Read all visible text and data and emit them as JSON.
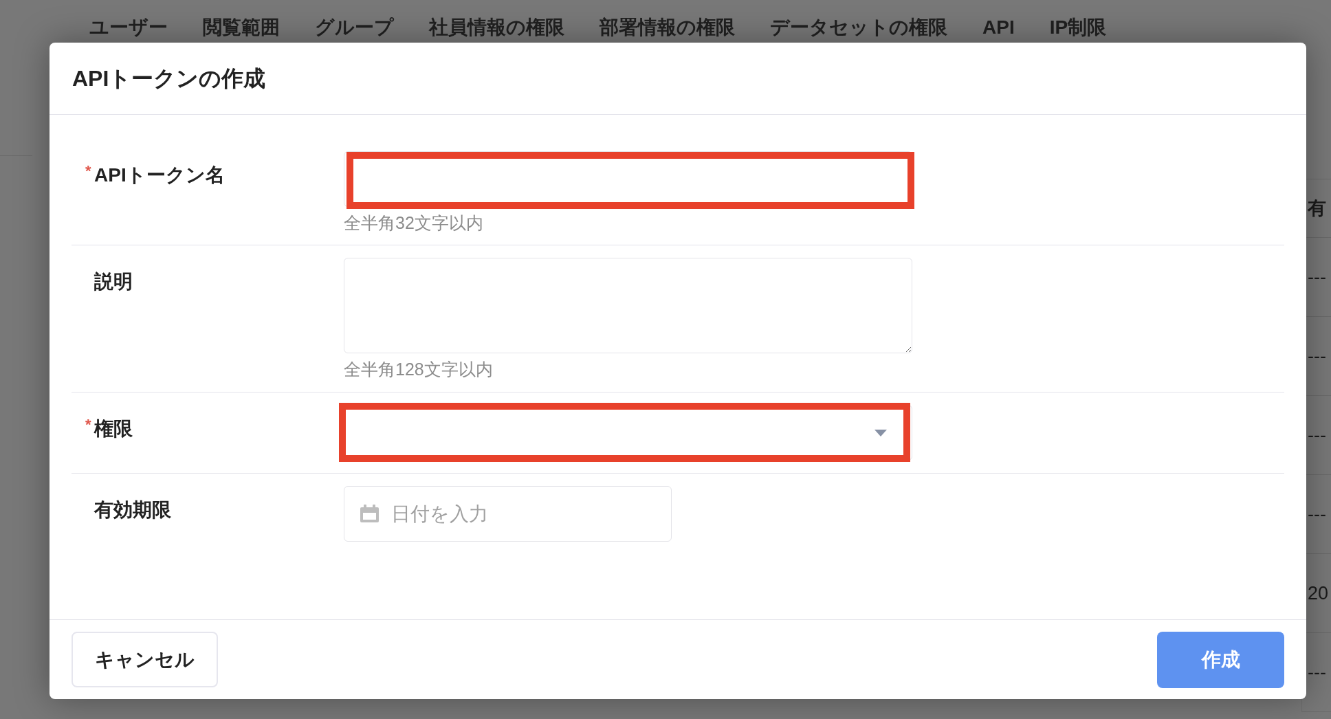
{
  "nav_tabs": [
    "ユーザー",
    "閲覧範囲",
    "グループ",
    "社員情報の権限",
    "部署情報の権限",
    "データセットの権限",
    "API",
    "IP制限"
  ],
  "background_table": {
    "column_header": "有",
    "cells": [
      "---",
      "---",
      "---",
      "---",
      "20",
      "---"
    ]
  },
  "dialog": {
    "title": "APIトークンの作成",
    "fields": [
      {
        "kind": "text",
        "required_mark": "*",
        "label": "APIトークン名",
        "hint": "全半角32文字以内",
        "highlighted": true
      },
      {
        "kind": "textarea",
        "label": "説明",
        "hint": "全半角128文字以内",
        "highlighted": false
      },
      {
        "kind": "select",
        "required_mark": "*",
        "label": "権限",
        "highlighted": true
      },
      {
        "kind": "date",
        "label": "有効期限",
        "placeholder": "日付を入力",
        "highlighted": false
      }
    ],
    "buttons": [
      {
        "kind": "secondary",
        "label": "キャンセル"
      },
      {
        "kind": "primary",
        "label": "作成"
      }
    ]
  }
}
